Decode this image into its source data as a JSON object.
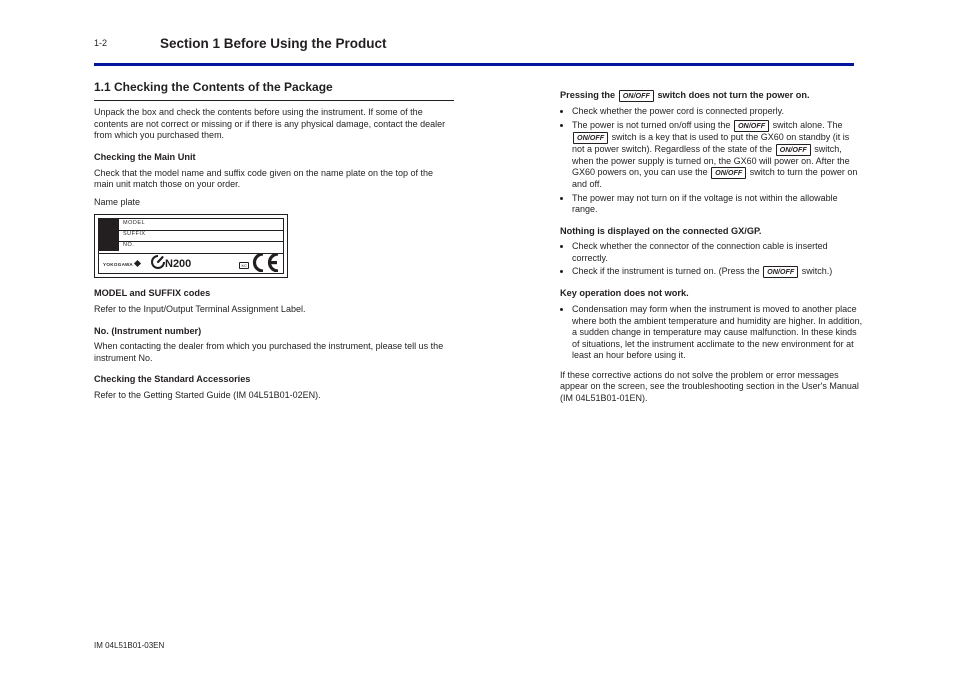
{
  "header": {
    "page_number": "1-2",
    "section_title": "Section 1  Before Using the Product"
  },
  "left": {
    "h3_11": "1.1  Checking the Contents of the Package",
    "p_intro": "Unpack the box and check the contents before using the instrument. If some of the contents are not correct or missing or if there is any physical damage, contact the dealer from which you purchased them.",
    "h4_check_main": "Checking the Main Unit",
    "p_check_main": "Check that the model name and suffix code given on the name plate on the top of the main unit match those on your order.",
    "img_label": "Name plate",
    "plate": {
      "model_lbl": "MODEL",
      "suffix_lbl": "SUFFIX",
      "no_lbl": "NO.",
      "brand": "YOKOGAWA",
      "ctick": "N200",
      "kc": "KC"
    },
    "h4_model": "MODEL and SUFFIX codes",
    "p_model": "Refer to the Input/Output Terminal Assignment Label.",
    "h4_no": "No. (Instrument number)",
    "p_no": "When contacting the dealer from which you purchased the instrument, please tell us the instrument No.",
    "h4_acc": "Checking the Standard Accessories",
    "p_acc": "Refer to the Getting Started Guide (IM 04L51B01-02EN)."
  },
  "right": {
    "h4_p1": "Pressing the",
    "h4_p2": "switch does not turn the power on.",
    "b0": "Check whether the power cord is connected properly.",
    "b1a": "The power is not turned on/off using the",
    "b1b": "switch alone. The",
    "b1c": "switch is a key that is used to put the GX60 on standby (it is not a power switch). Regardless of the state of the",
    "b1d": "switch, when the power supply is turned on, the GX60 will power on. After the GX60 powers on, you can use the",
    "b1e": "switch to turn the power on and off.",
    "b2": "The power may not turn on if the voltage is not within the allowable range.",
    "h4_no_disp": "Nothing is displayed on the connected GX/GP.",
    "b3": "Check whether the connector of the connection cable is inserted correctly.",
    "b4a": "Check if the instrument is turned on. (Press the",
    "b4b": "switch.)",
    "h4_key": "Key operation does not work.",
    "b5": "Condensation may form when the instrument is moved to another place where both the ambient temperature and humidity are higher. In addition, a sudden change in temperature may cause malfunction. In these kinds of situations, let the instrument acclimate to the new environment for at least an hour before using it.",
    "p_footer_a": "If these corrective actions do not solve the problem or error messages appear on the screen, see the troubleshooting section in the User's Manual (IM 04L51B01-01EN)."
  },
  "footer": {
    "short_model": "IM 04L51B01-03EN"
  },
  "key_label": "ON/OFF"
}
